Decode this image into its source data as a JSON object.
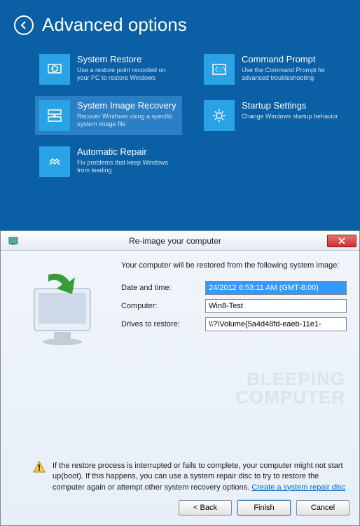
{
  "header": {
    "title": "Advanced options"
  },
  "tiles": [
    {
      "title": "System Restore",
      "desc": "Use a restore point recorded on your PC to restore Windows"
    },
    {
      "title": "Command Prompt",
      "desc": "Use the Command Prompt for advanced troubleshooting"
    },
    {
      "title": "System Image Recovery",
      "desc": "Recover Windows using a specific system image file"
    },
    {
      "title": "Startup Settings",
      "desc": "Change Windows startup behavior"
    },
    {
      "title": "Automatic Repair",
      "desc": "Fix problems that keep Windows from loading"
    }
  ],
  "dialog": {
    "title": "Re-image your computer",
    "intro": "Your computer will be restored from the following system image:",
    "fields": {
      "datetime_label": "Date and time:",
      "datetime_value": "24/2012 6:53:11 AM (GMT-8:00)",
      "computer_label": "Computer:",
      "computer_value": "Win8-Test",
      "drives_label": "Drives to restore:",
      "drives_value": "\\\\?\\Volume{5a4d48fd-eaeb-11e1-"
    },
    "warning": "If the restore process is interrupted or fails to complete, your computer might not start up(boot). If this happens, you can use a system repair disc to try to restore the computer again or attempt other system recovery options.",
    "link": "Create a system repair disc",
    "buttons": {
      "back": "< Back",
      "finish": "Finish",
      "cancel": "Cancel"
    },
    "watermark1": "BLEEPING",
    "watermark2": "COMPUTER"
  }
}
